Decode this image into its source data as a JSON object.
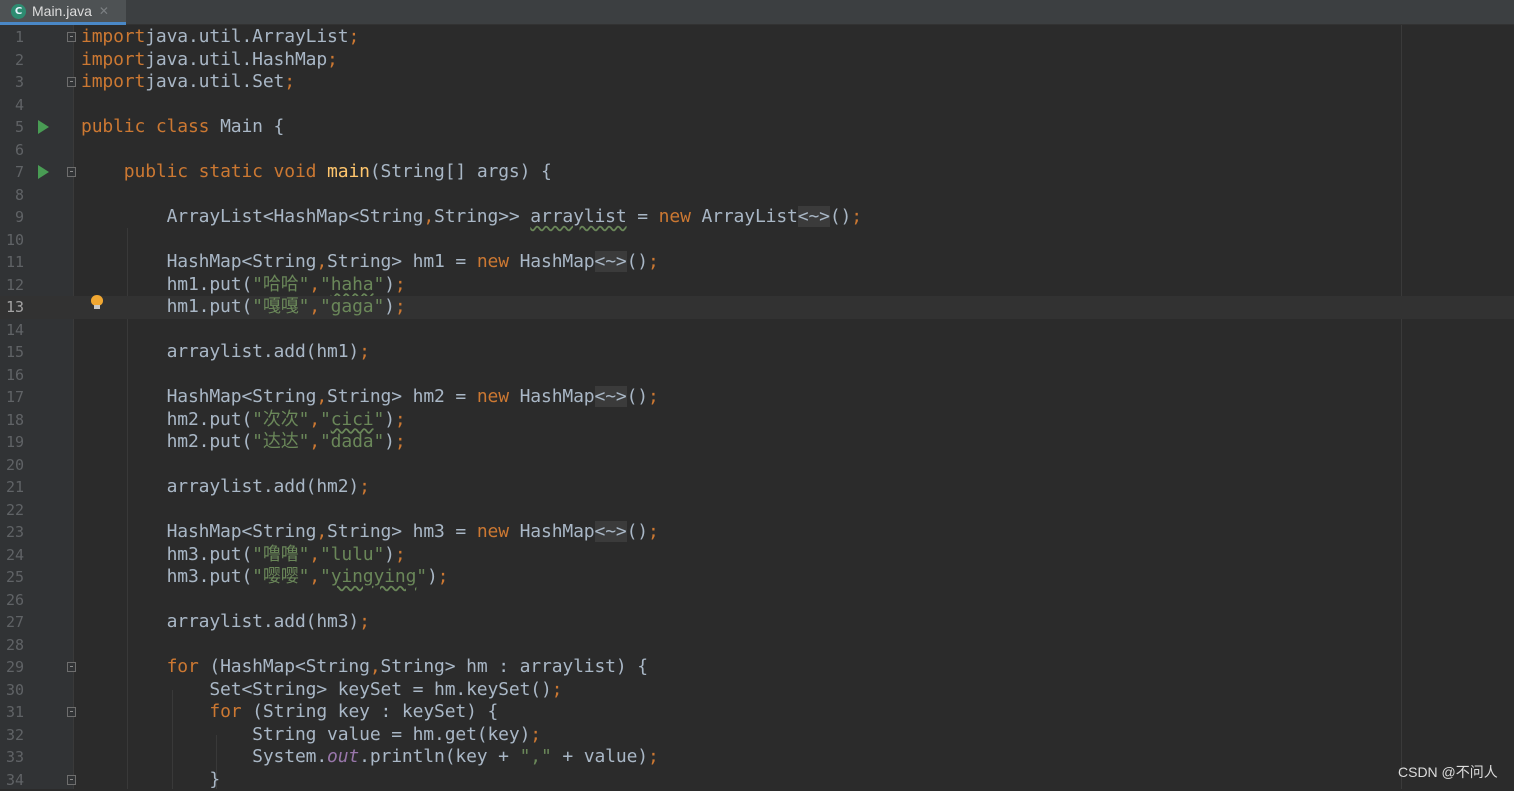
{
  "tab": {
    "filename": "Main.java",
    "icon": "java-class-icon",
    "close": "✕"
  },
  "watermark": "CSDN @不问人",
  "current_line": 13,
  "lines": [
    {
      "n": "1",
      "fold": true,
      "t": [
        [
          "kw",
          "import"
        ],
        [
          "",
          "java.util.ArrayList"
        ],
        [
          "kw",
          ";"
        ]
      ]
    },
    {
      "n": "2",
      "t": [
        [
          "kw",
          "import"
        ],
        [
          "",
          "java.util.HashMap"
        ],
        [
          "kw",
          ";"
        ]
      ]
    },
    {
      "n": "3",
      "fold": true,
      "t": [
        [
          "kw",
          "import"
        ],
        [
          "",
          "java.util.Set"
        ],
        [
          "kw",
          ";"
        ]
      ]
    },
    {
      "n": "4",
      "t": []
    },
    {
      "n": "5",
      "run": true,
      "t": [
        [
          "kw",
          "public class "
        ],
        [
          "",
          "Main {"
        ]
      ]
    },
    {
      "n": "6",
      "t": []
    },
    {
      "n": "7",
      "run": true,
      "fold": true,
      "t": [
        [
          "",
          "    "
        ],
        [
          "kw",
          "public static void "
        ],
        [
          "fn",
          "main"
        ],
        [
          "",
          "(String[] args) {"
        ]
      ]
    },
    {
      "n": "8",
      "t": []
    },
    {
      "n": "9",
      "t": [
        [
          "",
          "        ArrayList<HashMap<String"
        ],
        [
          "kw",
          ","
        ],
        [
          "",
          "String>> "
        ],
        [
          "warn",
          "arraylist"
        ],
        [
          "",
          " = "
        ],
        [
          "kw",
          "new "
        ],
        [
          "",
          "ArrayList"
        ],
        [
          "fold-hint",
          "<~>"
        ],
        [
          "",
          "()"
        ],
        [
          "kw",
          ";"
        ]
      ]
    },
    {
      "n": "10",
      "t": []
    },
    {
      "n": "11",
      "t": [
        [
          "",
          "        HashMap<String"
        ],
        [
          "kw",
          ","
        ],
        [
          "",
          "String> hm1 = "
        ],
        [
          "kw",
          "new "
        ],
        [
          "",
          "HashMap"
        ],
        [
          "fold-hint",
          "<~>"
        ],
        [
          "",
          "()"
        ],
        [
          "kw",
          ";"
        ]
      ]
    },
    {
      "n": "12",
      "t": [
        [
          "",
          "        hm1.put("
        ],
        [
          "str",
          "\"哈哈\""
        ],
        [
          "kw",
          ","
        ],
        [
          "str",
          "\""
        ],
        [
          "str warn",
          "haha"
        ],
        [
          "str",
          "\""
        ],
        [
          "",
          ")"
        ],
        [
          "kw",
          ";"
        ]
      ]
    },
    {
      "n": "13",
      "t": [
        [
          "",
          "        hm1.put("
        ],
        [
          "str",
          "\"嘎嘎\""
        ],
        [
          "kw",
          ","
        ],
        [
          "str",
          "\"gaga\""
        ],
        [
          "",
          ")"
        ],
        [
          "kw",
          ";"
        ]
      ]
    },
    {
      "n": "14",
      "t": []
    },
    {
      "n": "15",
      "t": [
        [
          "",
          "        arraylist.add(hm1)"
        ],
        [
          "kw",
          ";"
        ]
      ]
    },
    {
      "n": "16",
      "t": []
    },
    {
      "n": "17",
      "t": [
        [
          "",
          "        HashMap<String"
        ],
        [
          "kw",
          ","
        ],
        [
          "",
          "String> hm2 = "
        ],
        [
          "kw",
          "new "
        ],
        [
          "",
          "HashMap"
        ],
        [
          "fold-hint",
          "<~>"
        ],
        [
          "",
          "()"
        ],
        [
          "kw",
          ";"
        ]
      ]
    },
    {
      "n": "18",
      "t": [
        [
          "",
          "        hm2.put("
        ],
        [
          "str",
          "\"次次\""
        ],
        [
          "kw",
          ","
        ],
        [
          "str",
          "\""
        ],
        [
          "str warn",
          "cici"
        ],
        [
          "str",
          "\""
        ],
        [
          "",
          ")"
        ],
        [
          "kw",
          ";"
        ]
      ]
    },
    {
      "n": "19",
      "t": [
        [
          "",
          "        hm2.put("
        ],
        [
          "str",
          "\"达达\""
        ],
        [
          "kw",
          ","
        ],
        [
          "str",
          "\"dada\""
        ],
        [
          "",
          ")"
        ],
        [
          "kw",
          ";"
        ]
      ]
    },
    {
      "n": "20",
      "t": []
    },
    {
      "n": "21",
      "t": [
        [
          "",
          "        arraylist.add(hm2)"
        ],
        [
          "kw",
          ";"
        ]
      ]
    },
    {
      "n": "22",
      "t": []
    },
    {
      "n": "23",
      "t": [
        [
          "",
          "        HashMap<String"
        ],
        [
          "kw",
          ","
        ],
        [
          "",
          "String> hm3 = "
        ],
        [
          "kw",
          "new "
        ],
        [
          "",
          "HashMap"
        ],
        [
          "fold-hint",
          "<~>"
        ],
        [
          "",
          "()"
        ],
        [
          "kw",
          ";"
        ]
      ]
    },
    {
      "n": "24",
      "t": [
        [
          "",
          "        hm3.put("
        ],
        [
          "str",
          "\"噜噜\""
        ],
        [
          "kw",
          ","
        ],
        [
          "str",
          "\"lulu\""
        ],
        [
          "",
          ")"
        ],
        [
          "kw",
          ";"
        ]
      ]
    },
    {
      "n": "25",
      "t": [
        [
          "",
          "        hm3.put("
        ],
        [
          "str",
          "\"嘤嘤\""
        ],
        [
          "kw",
          ","
        ],
        [
          "str",
          "\""
        ],
        [
          "str warn",
          "yingying"
        ],
        [
          "str",
          "\""
        ],
        [
          "",
          ")"
        ],
        [
          "kw",
          ";"
        ]
      ]
    },
    {
      "n": "26",
      "t": []
    },
    {
      "n": "27",
      "t": [
        [
          "",
          "        arraylist.add(hm3)"
        ],
        [
          "kw",
          ";"
        ]
      ]
    },
    {
      "n": "28",
      "t": []
    },
    {
      "n": "29",
      "fold": true,
      "t": [
        [
          "",
          "        "
        ],
        [
          "kw",
          "for "
        ],
        [
          "",
          "(HashMap<String"
        ],
        [
          "kw",
          ","
        ],
        [
          "",
          "String> hm : arraylist) {"
        ]
      ]
    },
    {
      "n": "30",
      "t": [
        [
          "",
          "            Set<String> keySet = hm.keySet()"
        ],
        [
          "kw",
          ";"
        ]
      ]
    },
    {
      "n": "31",
      "fold": true,
      "t": [
        [
          "",
          "            "
        ],
        [
          "kw",
          "for "
        ],
        [
          "",
          "(String key : keySet) {"
        ]
      ]
    },
    {
      "n": "32",
      "t": [
        [
          "",
          "                String value = hm.get(key)"
        ],
        [
          "kw",
          ";"
        ]
      ]
    },
    {
      "n": "33",
      "t": [
        [
          "",
          "                System."
        ],
        [
          "sfield",
          "out"
        ],
        [
          "",
          ".println(key + "
        ],
        [
          "str",
          "\",\""
        ],
        [
          "",
          " + value)"
        ],
        [
          "kw",
          ";"
        ]
      ]
    },
    {
      "n": "34",
      "fold": true,
      "t": [
        [
          "",
          "            }"
        ]
      ]
    }
  ]
}
